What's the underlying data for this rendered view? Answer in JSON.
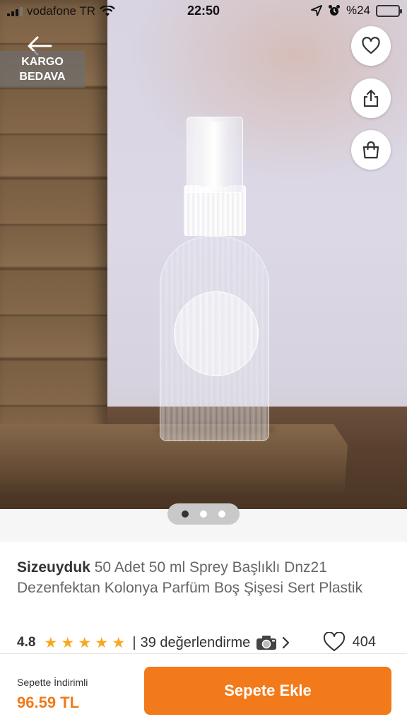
{
  "status_bar": {
    "carrier": "vodafone TR",
    "time": "22:50",
    "battery": "%24",
    "battery_level": 0.24
  },
  "product_image": {
    "badge": "KARGO\nBEDAVA",
    "carousel_pages": 3,
    "active_page": 0
  },
  "product": {
    "brand": "Sizeuyduk",
    "name": "50 Adet 50 ml Sprey Başlıklı Dnz21 Dezenfektan Kolonya Parfüm Boş Şişesi Sert Plastik",
    "rating": "4.8",
    "stars": 5,
    "separator": "|",
    "review_count": "39 değerlendirme",
    "favorites": "404"
  },
  "bottom_bar": {
    "price_label": "Sepette İndirimli",
    "price": "96.59 TL",
    "add_to_cart": "Sepete Ekle"
  },
  "colors": {
    "accent": "#f27a1a",
    "star": "#f8a820"
  },
  "icons": [
    "back-arrow-icon",
    "heart-icon",
    "share-icon",
    "shopping-bag-icon",
    "camera-icon",
    "chevron-right-icon",
    "wifi-icon",
    "location-icon",
    "alarm-icon"
  ]
}
